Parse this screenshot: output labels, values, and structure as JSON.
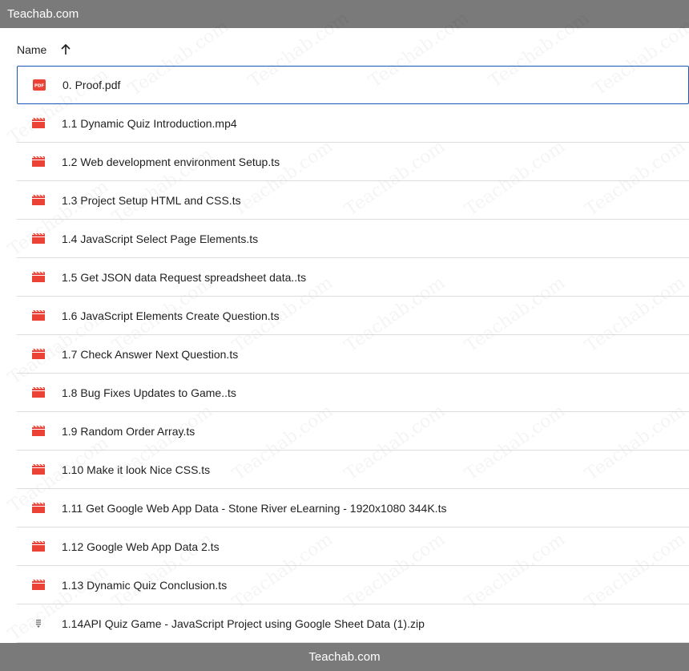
{
  "top_bar": {
    "title": "Teachab.com"
  },
  "bottom_bar": {
    "title": "Teachab.com"
  },
  "header": {
    "name_label": "Name",
    "sort_icon": "arrow-up-icon"
  },
  "watermark": {
    "text": "Teachab.com"
  },
  "colors": {
    "bar_bg": "#7a7a7a",
    "file_icon_red": "#ea4335",
    "selection_border": "#1a56b8",
    "divider": "#dadce0"
  },
  "files": [
    {
      "name": "0. Proof.pdf",
      "icon": "pdf-icon",
      "selected": true
    },
    {
      "name": "1.1 Dynamic Quiz Introduction.mp4",
      "icon": "video-icon"
    },
    {
      "name": "1.2 Web development environment Setup.ts",
      "icon": "video-icon"
    },
    {
      "name": "1.3 Project Setup HTML and CSS.ts",
      "icon": "video-icon"
    },
    {
      "name": "1.4 JavaScript Select Page Elements.ts",
      "icon": "video-icon"
    },
    {
      "name": "1.5 Get JSON data Request spreadsheet data..ts",
      "icon": "video-icon"
    },
    {
      "name": "1.6 JavaScript Elements Create Question.ts",
      "icon": "video-icon"
    },
    {
      "name": "1.7 Check Answer Next Question.ts",
      "icon": "video-icon"
    },
    {
      "name": "1.8 Bug Fixes Updates to Game..ts",
      "icon": "video-icon"
    },
    {
      "name": "1.9 Random Order Array.ts",
      "icon": "video-icon"
    },
    {
      "name": "1.10 Make it look Nice CSS.ts",
      "icon": "video-icon"
    },
    {
      "name": "1.11 Get Google Web App Data - Stone River eLearning - 1920x1080 344K.ts",
      "icon": "video-icon"
    },
    {
      "name": "1.12 Google Web App Data 2.ts",
      "icon": "video-icon"
    },
    {
      "name": "1.13 Dynamic Quiz Conclusion.ts",
      "icon": "video-icon"
    },
    {
      "name": "1.14API Quiz Game - JavaScript Project using Google Sheet Data (1).zip",
      "icon": "zip-icon"
    }
  ]
}
